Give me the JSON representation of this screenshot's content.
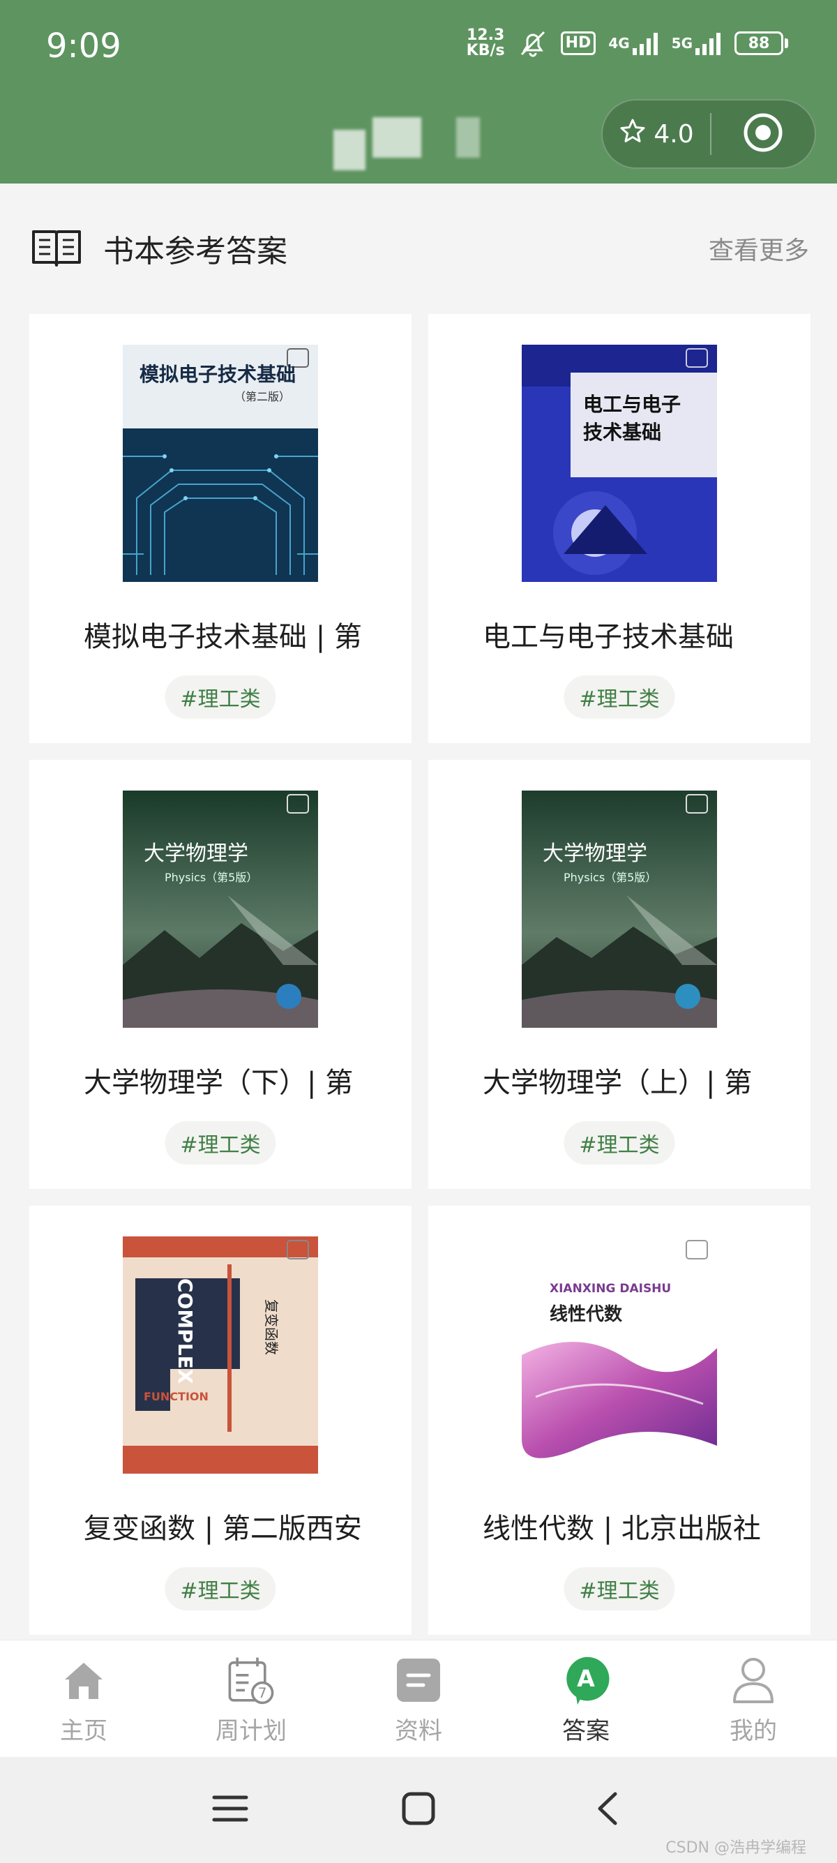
{
  "status_bar": {
    "time": "9:09",
    "net_speed_value": "12.3",
    "net_speed_unit": "KB/s",
    "hd_label": "HD",
    "net1": "4G",
    "net2": "5G",
    "battery": "88"
  },
  "capsule": {
    "rating": "4.0"
  },
  "section": {
    "title": "书本参考答案",
    "more_label": "查看更多"
  },
  "books": [
    {
      "title": "模拟电子技术基础 | 第",
      "tag": "#理工类",
      "cover_title": "模拟电子技术基础",
      "cover_sub": "（第二版）"
    },
    {
      "title": "电工与电子技术基础",
      "tag": "#理工类",
      "cover_title": "电工与电子",
      "cover_title2": "技术基础"
    },
    {
      "title": "大学物理学（下）| 第",
      "tag": "#理工类",
      "cover_title": "大学物理学",
      "cover_sub": "Physics（第5版）"
    },
    {
      "title": "大学物理学（上）| 第",
      "tag": "#理工类",
      "cover_title": "大学物理学",
      "cover_sub": "Physics（第5版）"
    },
    {
      "title": "复变函数 | 第二版西安",
      "tag": "#理工类",
      "cover_title": "复变函数",
      "cover_en": "COMPLEX",
      "cover_en2": "FUNCTION"
    },
    {
      "title": "线性代数 | 北京出版社",
      "tag": "#理工类",
      "cover_title": "线性代数",
      "cover_en": "XIANXING DAISHU"
    }
  ],
  "nav": [
    {
      "label": "主页",
      "icon": "home-icon"
    },
    {
      "label": "周计划",
      "icon": "calendar-icon",
      "badge": "7"
    },
    {
      "label": "资料",
      "icon": "document-icon"
    },
    {
      "label": "答案",
      "icon": "answer-icon",
      "badge": "A"
    },
    {
      "label": "我的",
      "icon": "profile-icon"
    }
  ],
  "watermark": "CSDN @浩冉学编程",
  "colors": {
    "theme_green": "#5e9460",
    "tag_green": "#3f7f45",
    "answer_green": "#2fa85a"
  }
}
